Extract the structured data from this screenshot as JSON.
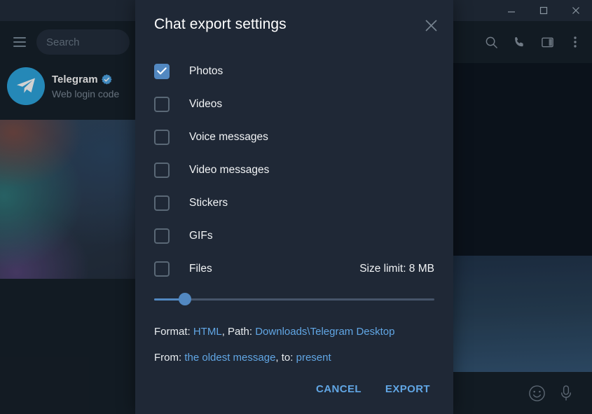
{
  "window": {
    "controls": [
      {
        "name": "minimize",
        "glyph": "minimize-icon"
      },
      {
        "name": "maximize",
        "glyph": "maximize-icon"
      },
      {
        "name": "close",
        "glyph": "close-icon"
      }
    ]
  },
  "sidebar": {
    "menu_icon": "hamburger-menu-icon",
    "search": {
      "placeholder": "Search"
    },
    "chats": [
      {
        "title": "Telegram",
        "verified": true,
        "preview": "Web login code",
        "avatar_icon": "telegram-plane-icon"
      }
    ]
  },
  "chat_pane": {
    "header_icons": [
      "search-icon",
      "phone-icon",
      "split-panel-icon",
      "more-vertical-icon"
    ],
    "composer_icons": [
      "emoji-icon",
      "microphone-icon"
    ]
  },
  "dialog": {
    "title": "Chat export settings",
    "close_icon": "close-icon",
    "options": [
      {
        "label": "Photos",
        "checked": true,
        "icon": "checkbox-checked-icon"
      },
      {
        "label": "Videos",
        "checked": false,
        "icon": "checkbox-icon"
      },
      {
        "label": "Voice messages",
        "checked": false,
        "icon": "checkbox-icon"
      },
      {
        "label": "Video messages",
        "checked": false,
        "icon": "checkbox-icon"
      },
      {
        "label": "Stickers",
        "checked": false,
        "icon": "checkbox-icon"
      },
      {
        "label": "GIFs",
        "checked": false,
        "icon": "checkbox-icon"
      },
      {
        "label": "Files",
        "checked": false,
        "icon": "checkbox-icon"
      }
    ],
    "size_limit_label": "Size limit: 8 MB",
    "size_slider": {
      "percent": 11
    },
    "format_line": {
      "format_prefix": "Format: ",
      "format_value": "HTML",
      "path_prefix": ", Path: ",
      "path_value": "Downloads\\Telegram Desktop"
    },
    "range_line": {
      "from_prefix": "From: ",
      "from_value": "the oldest message",
      "to_prefix": ", to: ",
      "to_value": "present"
    },
    "cancel_label": "CANCEL",
    "export_label": "EXPORT"
  },
  "colors": {
    "accent": "#5288c1",
    "link": "#61a6e4",
    "dialog_bg": "#1f2836",
    "app_bg": "#17212b",
    "chat_bg": "#0e1621"
  }
}
